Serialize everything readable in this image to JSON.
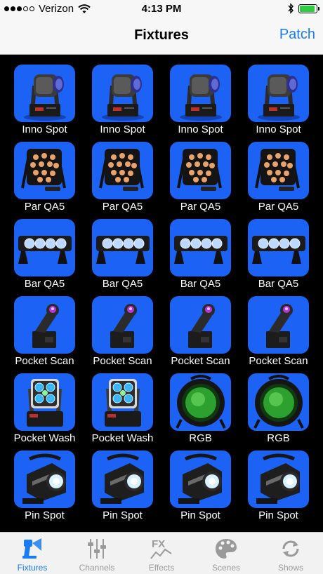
{
  "status": {
    "carrier": "Verizon",
    "time": "4:13 PM",
    "signal_bars_filled": 3,
    "signal_bars_total": 5,
    "battery_level": 0.9
  },
  "nav": {
    "title": "Fixtures",
    "action_label": "Patch"
  },
  "colors": {
    "tile_background": "#1c63f5",
    "accent": "#1a7cf5",
    "inactive_tab": "#9a9a9a"
  },
  "fixtures": [
    {
      "label": "Inno Spot",
      "icon": "moving-head-icon"
    },
    {
      "label": "Inno Spot",
      "icon": "moving-head-icon"
    },
    {
      "label": "Inno Spot",
      "icon": "moving-head-icon"
    },
    {
      "label": "Inno Spot",
      "icon": "moving-head-icon"
    },
    {
      "label": "Par QA5",
      "icon": "par-light-icon"
    },
    {
      "label": "Par QA5",
      "icon": "par-light-icon"
    },
    {
      "label": "Par QA5",
      "icon": "par-light-icon"
    },
    {
      "label": "Par QA5",
      "icon": "par-light-icon"
    },
    {
      "label": "Bar QA5",
      "icon": "light-bar-icon"
    },
    {
      "label": "Bar QA5",
      "icon": "light-bar-icon"
    },
    {
      "label": "Bar QA5",
      "icon": "light-bar-icon"
    },
    {
      "label": "Bar QA5",
      "icon": "light-bar-icon"
    },
    {
      "label": "Pocket Scan",
      "icon": "scanner-icon"
    },
    {
      "label": "Pocket Scan",
      "icon": "scanner-icon"
    },
    {
      "label": "Pocket Scan",
      "icon": "scanner-icon"
    },
    {
      "label": "Pocket Scan",
      "icon": "scanner-icon"
    },
    {
      "label": "Pocket Wash",
      "icon": "wash-light-icon"
    },
    {
      "label": "Pocket Wash",
      "icon": "wash-light-icon"
    },
    {
      "label": "RGB",
      "icon": "rgb-can-icon"
    },
    {
      "label": "RGB",
      "icon": "rgb-can-icon"
    },
    {
      "label": "Pin Spot",
      "icon": "pin-spot-icon"
    },
    {
      "label": "Pin Spot",
      "icon": "pin-spot-icon"
    },
    {
      "label": "Pin Spot",
      "icon": "pin-spot-icon"
    },
    {
      "label": "Pin Spot",
      "icon": "pin-spot-icon"
    }
  ],
  "tabs": [
    {
      "label": "Fixtures",
      "icon": "fixture-icon",
      "active": true
    },
    {
      "label": "Channels",
      "icon": "sliders-icon",
      "active": false
    },
    {
      "label": "Effects",
      "icon": "fx-icon",
      "active": false
    },
    {
      "label": "Scenes",
      "icon": "palette-icon",
      "active": false
    },
    {
      "label": "Shows",
      "icon": "cycle-icon",
      "active": false
    }
  ]
}
